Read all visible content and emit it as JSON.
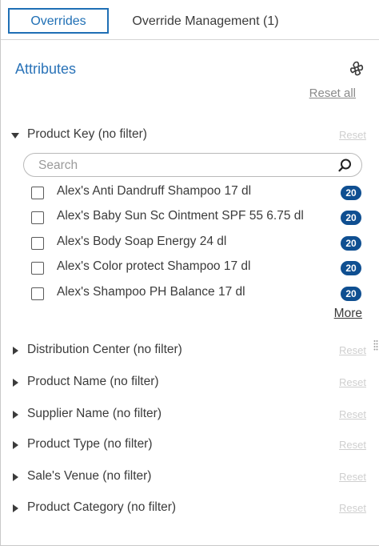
{
  "tabs": [
    {
      "label": "Overrides",
      "active": true
    },
    {
      "label": "Override Management (1)",
      "active": false
    }
  ],
  "attributes": {
    "title": "Attributes",
    "reset_all": "Reset all",
    "gear_icon": "settings-gear-icon"
  },
  "product_key": {
    "label": "Product Key (no filter)",
    "reset": "Reset",
    "expanded": true,
    "search_placeholder": "Search",
    "search_value": "",
    "items": [
      {
        "label": "Alex's Anti Dandruff Shampoo 17 dl",
        "count": "20",
        "checked": false
      },
      {
        "label": "Alex's Baby Sun Sc Ointment SPF 55 6.75 dl",
        "count": "20",
        "checked": false
      },
      {
        "label": "Alex's Body Soap Energy 24 dl",
        "count": "20",
        "checked": false
      },
      {
        "label": "Alex's Color protect Shampoo 17 dl",
        "count": "20",
        "checked": false
      },
      {
        "label": "Alex's Shampoo PH Balance 17 dl",
        "count": "20",
        "checked": false
      }
    ],
    "more": "More"
  },
  "sections": [
    {
      "label": "Distribution Center (no filter)",
      "reset": "Reset"
    },
    {
      "label": "Product Name (no filter)",
      "reset": "Reset"
    },
    {
      "label": "Supplier Name (no filter)",
      "reset": "Reset"
    },
    {
      "label": "Product Type (no filter)",
      "reset": "Reset"
    },
    {
      "label": "Sale's Venue (no filter)",
      "reset": "Reset"
    },
    {
      "label": "Product Category (no filter)",
      "reset": "Reset"
    }
  ],
  "colors": {
    "accent": "#1f6fb5",
    "badge": "#0f4f91",
    "disabled_reset": "#cfcfcf"
  }
}
